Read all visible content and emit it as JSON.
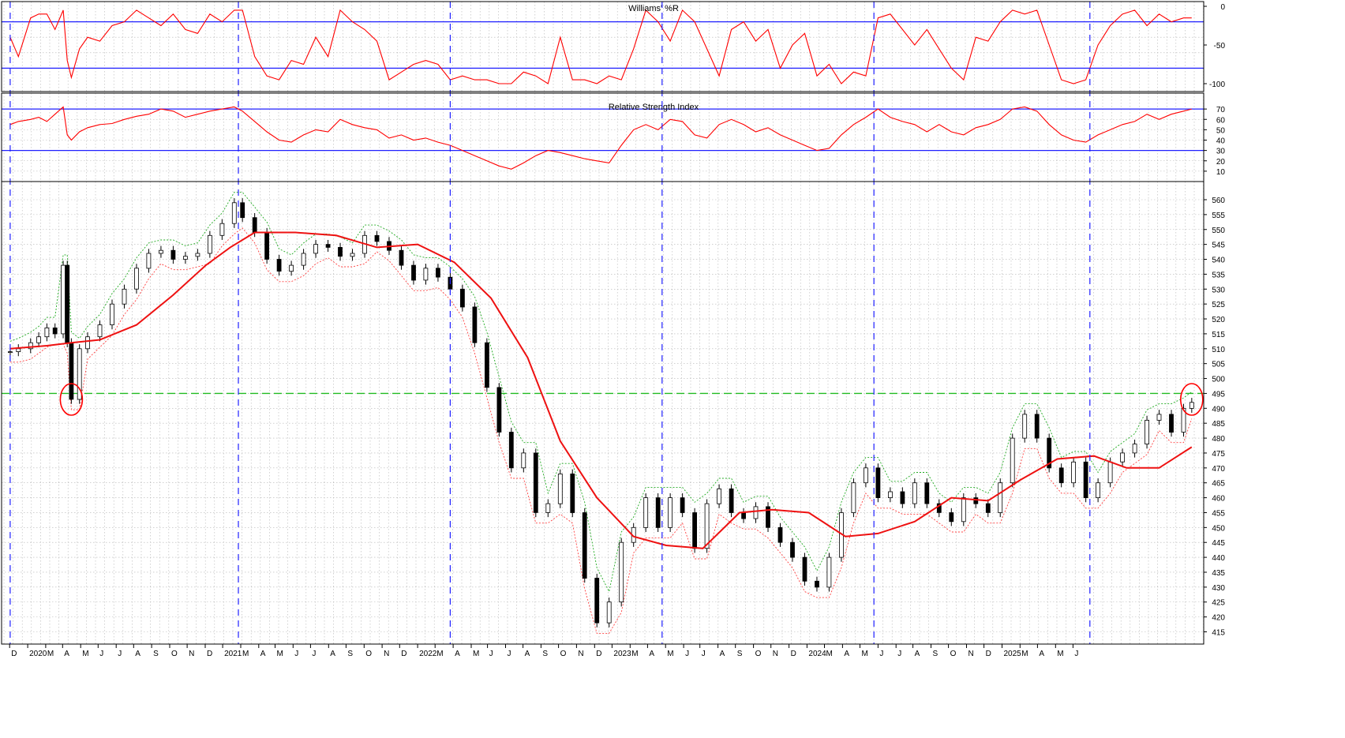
{
  "colors": {
    "background": "#ffffff",
    "grid": "#b4b4b4",
    "reference_blue": "#2020ff",
    "indicator_red": "#ff0000",
    "ma_red": "#ee1111",
    "envelope_upper_green": "#22aa22",
    "envelope_lower_red": "#ff4040",
    "threshold_green": "#22bb22",
    "candle": "#000000",
    "axis_text": "#000000"
  },
  "chart_data": [
    {
      "type": "line",
      "title": "Williams' %R",
      "yticks": [
        0,
        -50,
        -100
      ],
      "ylim": [
        -100,
        0
      ],
      "reference_lines": [
        -20,
        -80
      ],
      "series": [
        {
          "x": [
            "2019-12-02",
            "2019-12-16",
            "2020-01-06",
            "2020-01-20",
            "2020-02-03",
            "2020-02-17",
            "2020-03-02",
            "2020-03-09",
            "2020-03-16",
            "2020-03-30",
            "2020-04-13",
            "2020-05-04",
            "2020-05-25",
            "2020-06-15",
            "2020-07-06",
            "2020-07-27",
            "2020-08-17",
            "2020-09-07",
            "2020-09-28",
            "2020-10-19",
            "2020-11-09",
            "2020-11-30",
            "2020-12-21",
            "2021-01-04",
            "2021-01-25",
            "2021-02-15",
            "2021-03-08",
            "2021-03-29",
            "2021-04-19",
            "2021-05-10",
            "2021-05-31",
            "2021-06-21",
            "2021-07-12",
            "2021-08-02",
            "2021-08-23",
            "2021-09-13",
            "2021-10-04",
            "2021-10-25",
            "2021-11-15",
            "2021-12-06",
            "2021-12-27",
            "2022-01-17",
            "2022-02-07",
            "2022-02-28",
            "2022-03-21",
            "2022-04-11",
            "2022-05-02",
            "2022-05-23",
            "2022-06-13",
            "2022-07-04",
            "2022-07-25",
            "2022-08-15",
            "2022-09-05",
            "2022-09-26",
            "2022-10-17",
            "2022-11-07",
            "2022-11-28",
            "2022-12-19",
            "2023-01-09",
            "2023-01-30",
            "2023-02-20",
            "2023-03-13",
            "2023-04-03",
            "2023-04-24",
            "2023-05-15",
            "2023-06-05",
            "2023-06-26",
            "2023-07-17",
            "2023-08-07",
            "2023-08-28",
            "2023-09-18",
            "2023-10-09",
            "2023-10-30",
            "2023-11-20",
            "2023-12-11",
            "2024-01-01",
            "2024-01-22",
            "2024-02-12",
            "2024-03-04",
            "2024-03-25",
            "2024-04-15",
            "2024-05-06",
            "2024-05-27",
            "2024-06-17",
            "2024-07-08",
            "2024-07-29",
            "2024-08-19",
            "2024-09-09",
            "2024-09-30",
            "2024-10-21",
            "2024-11-11",
            "2024-12-02",
            "2024-12-23",
            "2025-01-13",
            "2025-02-03",
            "2025-02-24",
            "2025-03-17",
            "2025-04-07",
            "2025-04-28",
            "2025-05-19",
            "2025-06-09",
            "2025-06-23"
          ],
          "values": [
            -40,
            -65,
            -15,
            -10,
            -10,
            -30,
            -5,
            -70,
            -92,
            -55,
            -40,
            -45,
            -25,
            -20,
            -5,
            -15,
            -25,
            -10,
            -30,
            -35,
            -10,
            -20,
            -5,
            -5,
            -65,
            -90,
            -95,
            -70,
            -75,
            -40,
            -65,
            -5,
            -20,
            -30,
            -45,
            -95,
            -85,
            -75,
            -70,
            -75,
            -95,
            -90,
            -95,
            -95,
            -100,
            -100,
            -85,
            -90,
            -100,
            -40,
            -95,
            -95,
            -100,
            -90,
            -95,
            -55,
            -5,
            -20,
            -45,
            -5,
            -20,
            -55,
            -90,
            -30,
            -20,
            -45,
            -30,
            -80,
            -50,
            -35,
            -90,
            -75,
            -100,
            -85,
            -90,
            -15,
            -10,
            -30,
            -50,
            -30,
            -55,
            -80,
            -95,
            -40,
            -45,
            -20,
            -5,
            -10,
            -5,
            -50,
            -95,
            -100,
            -95,
            -50,
            -25,
            -10,
            -5,
            -25,
            -10,
            -20,
            -15,
            -15
          ]
        }
      ]
    },
    {
      "type": "line",
      "title": "Relative Strength Index",
      "yticks": [
        70,
        60,
        50,
        40,
        30,
        20,
        10
      ],
      "ylim": [
        0,
        80
      ],
      "reference_lines": [
        70,
        30
      ],
      "series": [
        {
          "x": [
            "2019-12-02",
            "2019-12-16",
            "2020-01-06",
            "2020-01-20",
            "2020-02-03",
            "2020-02-17",
            "2020-03-02",
            "2020-03-09",
            "2020-03-16",
            "2020-03-30",
            "2020-04-13",
            "2020-05-04",
            "2020-05-25",
            "2020-06-15",
            "2020-07-06",
            "2020-07-27",
            "2020-08-17",
            "2020-09-07",
            "2020-09-28",
            "2020-10-19",
            "2020-11-09",
            "2020-11-30",
            "2020-12-21",
            "2021-01-04",
            "2021-01-25",
            "2021-02-15",
            "2021-03-08",
            "2021-03-29",
            "2021-04-19",
            "2021-05-10",
            "2021-05-31",
            "2021-06-21",
            "2021-07-12",
            "2021-08-02",
            "2021-08-23",
            "2021-09-13",
            "2021-10-04",
            "2021-10-25",
            "2021-11-15",
            "2021-12-06",
            "2021-12-27",
            "2022-01-17",
            "2022-02-07",
            "2022-02-28",
            "2022-03-21",
            "2022-04-11",
            "2022-05-02",
            "2022-05-23",
            "2022-06-13",
            "2022-07-04",
            "2022-07-25",
            "2022-08-15",
            "2022-09-05",
            "2022-09-26",
            "2022-10-17",
            "2022-11-07",
            "2022-11-28",
            "2022-12-19",
            "2023-01-09",
            "2023-01-30",
            "2023-02-20",
            "2023-03-13",
            "2023-04-03",
            "2023-04-24",
            "2023-05-15",
            "2023-06-05",
            "2023-06-26",
            "2023-07-17",
            "2023-08-07",
            "2023-08-28",
            "2023-09-18",
            "2023-10-09",
            "2023-10-30",
            "2023-11-20",
            "2023-12-11",
            "2024-01-01",
            "2024-01-22",
            "2024-02-12",
            "2024-03-04",
            "2024-03-25",
            "2024-04-15",
            "2024-05-06",
            "2024-05-27",
            "2024-06-17",
            "2024-07-08",
            "2024-07-29",
            "2024-08-19",
            "2024-09-09",
            "2024-09-30",
            "2024-10-21",
            "2024-11-11",
            "2024-12-02",
            "2024-12-23",
            "2025-01-13",
            "2025-02-03",
            "2025-02-24",
            "2025-03-17",
            "2025-04-07",
            "2025-04-28",
            "2025-05-19",
            "2025-06-09",
            "2025-06-23"
          ],
          "values": [
            55,
            58,
            60,
            62,
            58,
            65,
            72,
            45,
            40,
            48,
            52,
            55,
            56,
            60,
            63,
            65,
            70,
            68,
            62,
            65,
            68,
            70,
            72,
            68,
            58,
            48,
            40,
            38,
            45,
            50,
            48,
            60,
            55,
            52,
            50,
            42,
            45,
            40,
            42,
            38,
            35,
            30,
            25,
            20,
            15,
            12,
            18,
            25,
            30,
            28,
            25,
            22,
            20,
            18,
            35,
            50,
            55,
            50,
            60,
            58,
            45,
            42,
            55,
            60,
            55,
            48,
            52,
            45,
            40,
            35,
            30,
            32,
            45,
            55,
            62,
            70,
            62,
            58,
            55,
            48,
            55,
            48,
            45,
            52,
            55,
            60,
            70,
            72,
            68,
            55,
            45,
            40,
            38,
            45,
            50,
            55,
            58,
            65,
            60,
            65,
            68,
            70
          ]
        }
      ]
    },
    {
      "type": "candlestick",
      "title": "",
      "yticks": [
        560,
        555,
        550,
        545,
        540,
        535,
        530,
        525,
        520,
        515,
        510,
        505,
        500,
        495,
        490,
        485,
        480,
        475,
        470,
        465,
        460,
        455,
        450,
        445,
        440,
        435,
        430,
        425,
        420,
        415
      ],
      "ylim": [
        413,
        564
      ],
      "xtick_labels": [
        "D",
        "2020",
        "M",
        "A",
        "M",
        "J",
        "J",
        "A",
        "S",
        "O",
        "N",
        "D",
        "2021",
        "M",
        "A",
        "M",
        "J",
        "J",
        "A",
        "S",
        "O",
        "N",
        "D",
        "2022",
        "M",
        "A",
        "M",
        "J",
        "J",
        "A",
        "S",
        "O",
        "N",
        "D",
        "2023",
        "M",
        "A",
        "M",
        "J",
        "J",
        "A",
        "S",
        "O",
        "N",
        "D",
        "2024",
        "M",
        "A",
        "M",
        "J",
        "J",
        "A",
        "S",
        "O",
        "N",
        "D",
        "2025",
        "M",
        "A",
        "M",
        "J"
      ],
      "reference_line": {
        "value": 495,
        "style": "dashed"
      },
      "highlight_circles": [
        {
          "date": "2020-03-16",
          "value": 493
        },
        {
          "date": "2025-06-23",
          "value": 493
        }
      ],
      "moving_average": {
        "x": [
          "2019-12-02",
          "2020-02-03",
          "2020-03-16",
          "2020-05-04",
          "2020-07-06",
          "2020-09-07",
          "2020-11-02",
          "2020-12-14",
          "2021-01-25",
          "2021-04-05",
          "2021-06-14",
          "2021-08-23",
          "2021-11-01",
          "2022-01-03",
          "2022-03-07",
          "2022-05-09",
          "2022-07-04",
          "2022-09-05",
          "2022-11-07",
          "2023-01-02",
          "2023-03-06",
          "2023-05-08",
          "2023-07-03",
          "2023-09-04",
          "2023-11-06",
          "2024-01-01",
          "2024-03-04",
          "2024-05-06",
          "2024-07-08",
          "2024-09-02",
          "2024-11-04",
          "2025-01-06",
          "2025-03-03",
          "2025-04-28",
          "2025-06-23"
        ],
        "values": [
          510,
          511,
          512,
          513,
          518,
          528,
          538,
          544,
          549,
          549,
          548,
          544,
          545,
          539,
          527,
          507,
          479,
          460,
          447,
          444,
          443,
          455,
          456,
          455,
          447,
          448,
          452,
          460,
          459,
          466,
          473,
          474,
          470,
          470,
          477
        ]
      },
      "series": [
        {
          "x": [
            "2019-12-02",
            "2019-12-16",
            "2020-01-06",
            "2020-01-20",
            "2020-02-03",
            "2020-02-17",
            "2020-03-02",
            "2020-03-09",
            "2020-03-16",
            "2020-03-30",
            "2020-04-13",
            "2020-05-04",
            "2020-05-25",
            "2020-06-15",
            "2020-07-06",
            "2020-07-27",
            "2020-08-17",
            "2020-09-07",
            "2020-09-28",
            "2020-10-19",
            "2020-11-09",
            "2020-11-30",
            "2020-12-21",
            "2021-01-04",
            "2021-01-25",
            "2021-02-15",
            "2021-03-08",
            "2021-03-29",
            "2021-04-19",
            "2021-05-10",
            "2021-05-31",
            "2021-06-21",
            "2021-07-12",
            "2021-08-02",
            "2021-08-23",
            "2021-09-13",
            "2021-10-04",
            "2021-10-25",
            "2021-11-15",
            "2021-12-06",
            "2021-12-27",
            "2022-01-17",
            "2022-02-07",
            "2022-02-28",
            "2022-03-21",
            "2022-04-11",
            "2022-05-02",
            "2022-05-23",
            "2022-06-13",
            "2022-07-04",
            "2022-07-25",
            "2022-08-15",
            "2022-09-05",
            "2022-09-26",
            "2022-10-17",
            "2022-11-07",
            "2022-11-28",
            "2022-12-19",
            "2023-01-09",
            "2023-01-30",
            "2023-02-20",
            "2023-03-13",
            "2023-04-03",
            "2023-04-24",
            "2023-05-15",
            "2023-06-05",
            "2023-06-26",
            "2023-07-17",
            "2023-08-07",
            "2023-08-28",
            "2023-09-18",
            "2023-10-09",
            "2023-10-30",
            "2023-11-20",
            "2023-12-11",
            "2024-01-01",
            "2024-01-22",
            "2024-02-12",
            "2024-03-04",
            "2024-03-25",
            "2024-04-15",
            "2024-05-06",
            "2024-05-27",
            "2024-06-17",
            "2024-07-08",
            "2024-07-29",
            "2024-08-19",
            "2024-09-09",
            "2024-09-30",
            "2024-10-21",
            "2024-11-11",
            "2024-12-02",
            "2024-12-23",
            "2025-01-13",
            "2025-02-03",
            "2025-02-24",
            "2025-03-17",
            "2025-04-07",
            "2025-04-28",
            "2025-05-19",
            "2025-06-09",
            "2025-06-23"
          ],
          "values": [
            509,
            510,
            512,
            514,
            517,
            515,
            538,
            512,
            493,
            510,
            514,
            518,
            525,
            530,
            537,
            542,
            543,
            540,
            541,
            542,
            548,
            552,
            559,
            554,
            549,
            540,
            536,
            538,
            542,
            545,
            544,
            541,
            542,
            548,
            546,
            543,
            538,
            533,
            537,
            534,
            530,
            524,
            512,
            497,
            482,
            470,
            475,
            455,
            458,
            468,
            455,
            433,
            418,
            425,
            445,
            450,
            460,
            450,
            460,
            455,
            443,
            458,
            463,
            455,
            453,
            457,
            450,
            445,
            440,
            432,
            430,
            440,
            455,
            465,
            470,
            460,
            462,
            458,
            465,
            458,
            455,
            452,
            460,
            458,
            455,
            465,
            480,
            488,
            480,
            470,
            465,
            472,
            460,
            465,
            472,
            475,
            478,
            486,
            488,
            482,
            490,
            492
          ]
        }
      ]
    }
  ]
}
